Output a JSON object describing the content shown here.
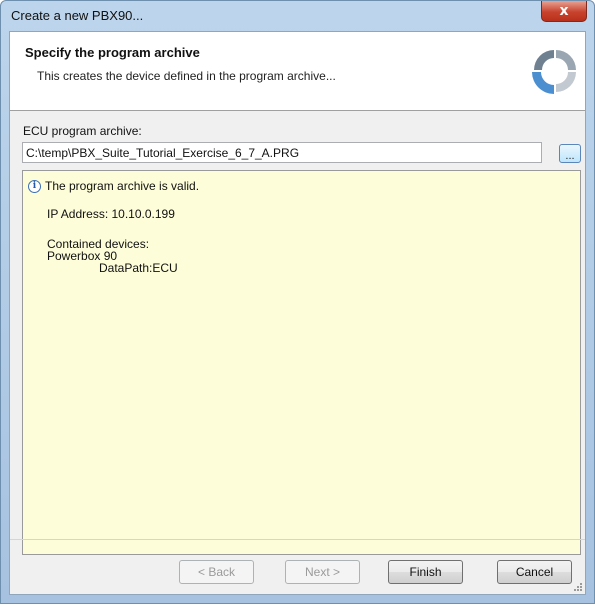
{
  "window": {
    "title": "Create a new PBX90...",
    "close_glyph": "x"
  },
  "header": {
    "title": "Specify the program archive",
    "subtitle": "This creates the device defined in the program archive...",
    "logo_icon": "wizard-logo-icon"
  },
  "archive": {
    "label": "ECU program archive:",
    "path_value": "C:\\temp\\PBX_Suite_Tutorial_Exercise_6_7_A.PRG",
    "browse_label": "..."
  },
  "info": {
    "icon": "info-icon",
    "icon_glyph": "i",
    "valid_message": "The program archive is valid.",
    "ip_line": "IP Address: 10.10.0.199",
    "contained_label": "Contained devices:",
    "device_name": "Powerbox 90",
    "datapath": "DataPath:ECU"
  },
  "buttons": {
    "back": "< Back",
    "next": "Next >",
    "finish": "Finish",
    "cancel": "Cancel"
  },
  "colors": {
    "title_bar": "#bdd5ec",
    "info_background": "#fdfdd9",
    "close_button": "#c8432d"
  }
}
